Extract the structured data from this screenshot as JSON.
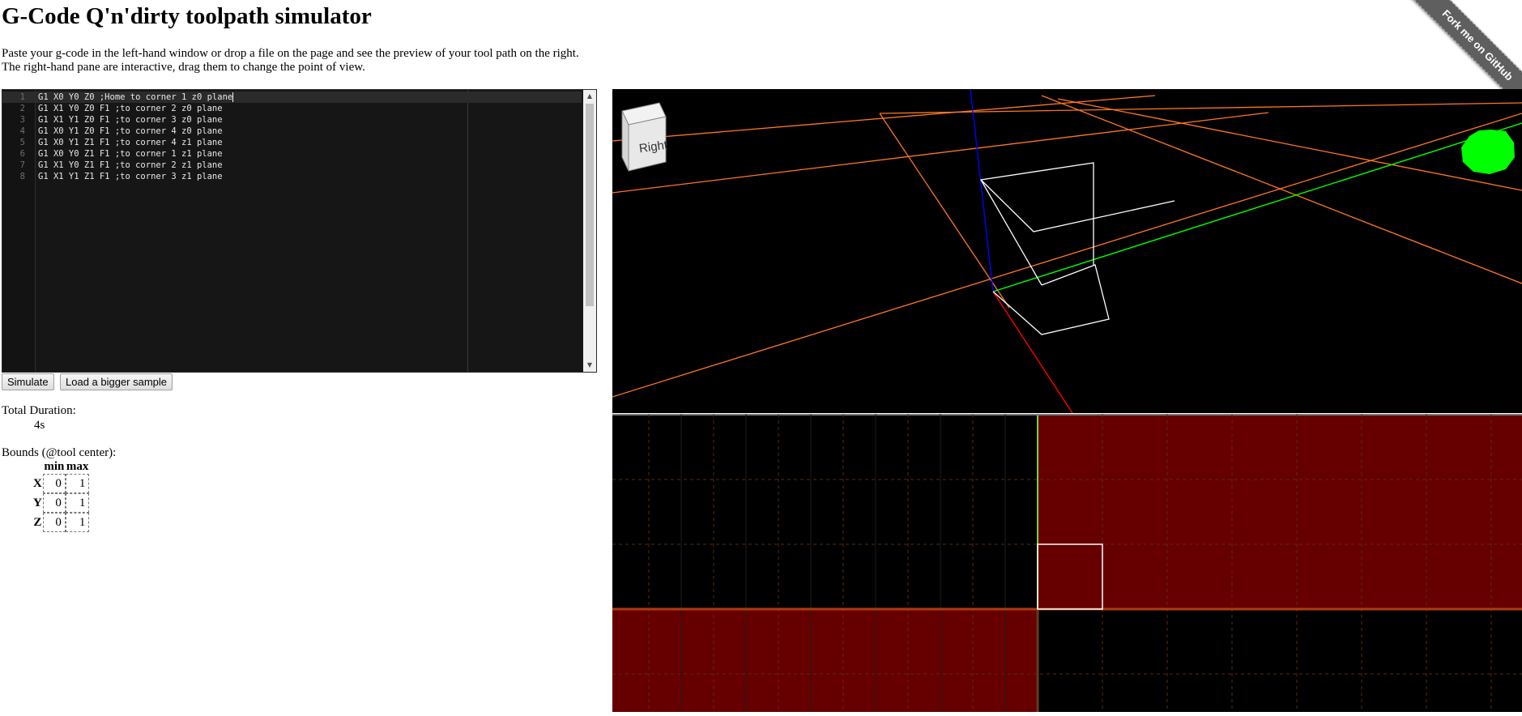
{
  "page": {
    "title": "G-Code Q'n'dirty toolpath simulator",
    "intro_line1": "Paste your g-code in the left-hand window or drop a file on the page and see the preview of your tool path on the right.",
    "intro_line2": "The right-hand pane are interactive, drag them to change the point of view.",
    "ribbon": "Fork me on GitHub"
  },
  "editor": {
    "lines": [
      {
        "n": "1",
        "code": "G1 X0 Y0 Z0 ;Home to corner 1 z0 plane"
      },
      {
        "n": "2",
        "code": "G1 X1 Y0 Z0 F1 ;to corner 2 z0 plane"
      },
      {
        "n": "3",
        "code": "G1 X1 Y1 Z0 F1 ;to corner 3 z0 plane"
      },
      {
        "n": "4",
        "code": "G1 X0 Y1 Z0 F1 ;to corner 4 z0 plane"
      },
      {
        "n": "5",
        "code": "G1 X0 Y1 Z1 F1 ;to corner 4 z1 plane"
      },
      {
        "n": "6",
        "code": "G1 X0 Y0 Z1 F1 ;to corner 1 z1 plane"
      },
      {
        "n": "7",
        "code": "G1 X1 Y0 Z1 F1 ;to corner 2 z1 plane"
      },
      {
        "n": "8",
        "code": "G1 X1 Y1 Z1 F1 ;to corner 3 z1 plane"
      }
    ]
  },
  "buttons": {
    "simulate": "Simulate",
    "load_sample": "Load a bigger sample"
  },
  "stats": {
    "duration_label": "Total Duration:",
    "duration_value": "4s",
    "bounds_label": "Bounds (@tool center):",
    "bounds_headers": [
      "min",
      "max"
    ],
    "bounds_rows": [
      {
        "axis": "X",
        "min": "0",
        "max": "1"
      },
      {
        "axis": "Y",
        "min": "0",
        "max": "1"
      },
      {
        "axis": "Z",
        "min": "0",
        "max": "1"
      }
    ]
  },
  "view3d": {
    "cube_label": "Right",
    "colors": {
      "x_axis": "#ff0000",
      "y_axis": "#00ff00",
      "z_axis": "#0000ff",
      "grid": "#ff7722",
      "toolpath": "#ffffff",
      "tool": "#00ff00"
    }
  },
  "view2d": {
    "colors": {
      "fill": "#660000",
      "grid": "#5a2a10",
      "toolpath": "#ffffff"
    }
  }
}
